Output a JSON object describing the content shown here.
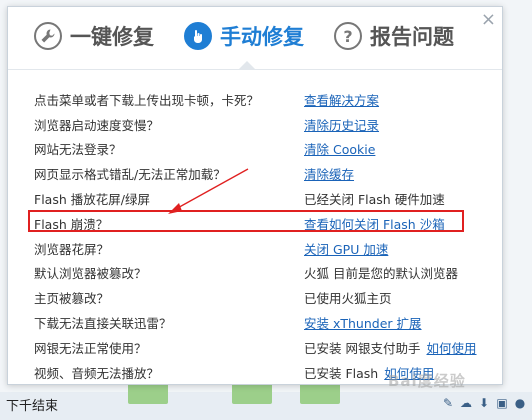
{
  "tabs": [
    {
      "label": "一键修复",
      "icon": "wrench-icon",
      "active": false
    },
    {
      "label": "手动修复",
      "icon": "hand-pointer-icon",
      "active": true
    },
    {
      "label": "报告问题",
      "icon": "question-icon",
      "active": false
    }
  ],
  "close_label": "×",
  "rows": [
    {
      "question": "点击菜单或者下载上传出现卡顿，卡死？",
      "prefix": "",
      "link": "查看解决方案"
    },
    {
      "question": "浏览器启动速度变慢？",
      "prefix": "",
      "link": "清除历史记录"
    },
    {
      "question": "网站无法登录？",
      "prefix": "",
      "link": "清除 Cookie"
    },
    {
      "question": "网页显示格式错乱/无法正常加载？",
      "prefix": "",
      "link": "清除缓存"
    },
    {
      "question": "Flash 播放花屏/绿屏",
      "prefix": "已经关闭 Flash 硬件加速",
      "link": ""
    },
    {
      "question": "Flash 崩溃？",
      "prefix": "",
      "link": "查看如何关闭 Flash 沙箱"
    },
    {
      "question": "浏览器花屏？",
      "prefix": "",
      "link": "关闭 GPU 加速"
    },
    {
      "question": "默认浏览器被篡改？",
      "prefix": "火狐 目前是您的默认浏览器",
      "link": ""
    },
    {
      "question": "主页被篡改？",
      "prefix": "已使用火狐主页",
      "link": ""
    },
    {
      "question": "下载无法直接关联迅雷？",
      "prefix": "",
      "link": "安装 xThunder 扩展"
    },
    {
      "question": "网银无法正常使用？",
      "prefix": "已安装 网银支付助手",
      "link": "如何使用"
    },
    {
      "question": "视频、音频无法播放？",
      "prefix": "已安装 Flash",
      "link": "如何使用"
    }
  ],
  "background": {
    "left_text": "下千结束"
  },
  "watermark": "Bai度经验",
  "colors": {
    "accent": "#1f7ed4",
    "link": "#1a63b8",
    "highlight": "#e02020"
  }
}
